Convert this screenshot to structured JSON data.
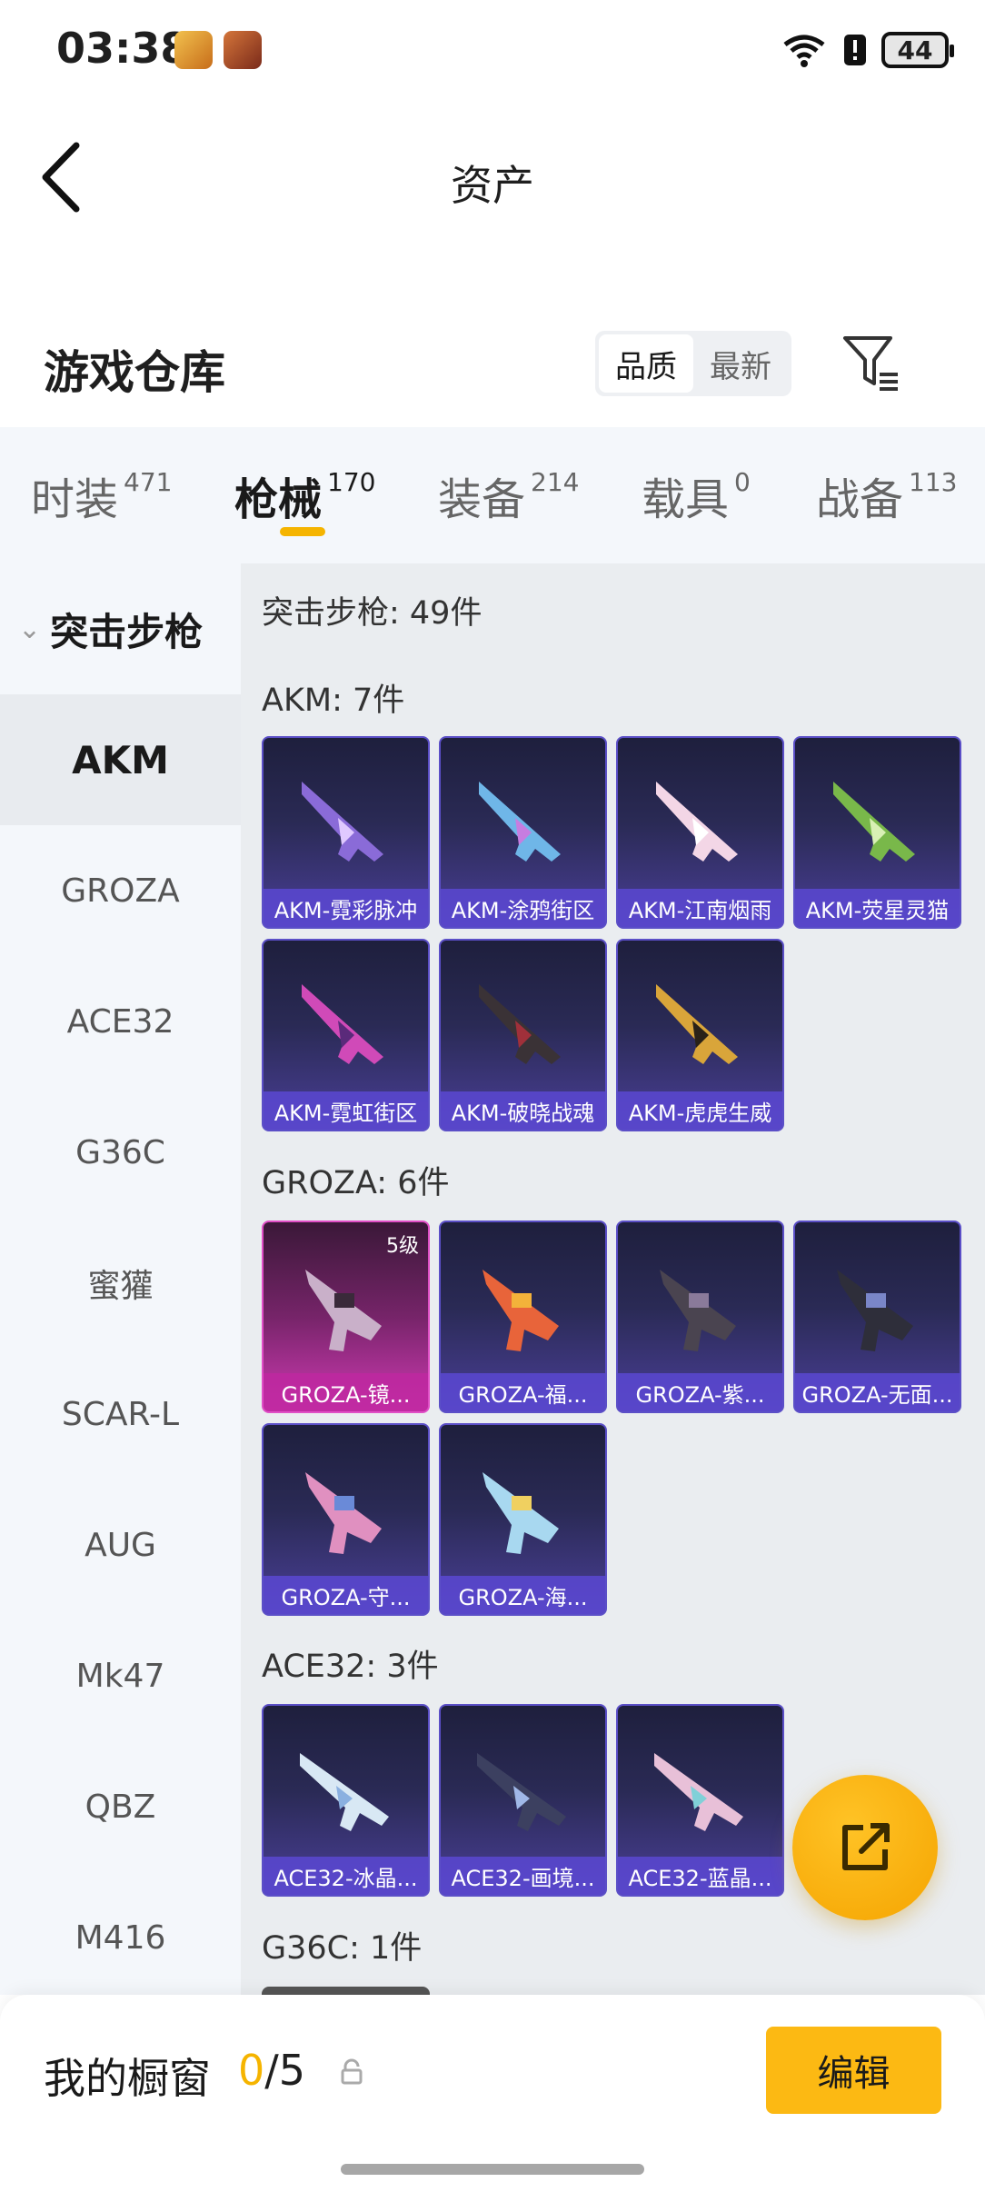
{
  "status_bar": {
    "time": "03:38",
    "battery": "44"
  },
  "header": {
    "title": "资产"
  },
  "warehouse": {
    "title": "游戏仓库",
    "sort_options": [
      "品质",
      "最新"
    ],
    "active_sort": "品质"
  },
  "tabs": [
    {
      "label": "时装",
      "count": "471"
    },
    {
      "label": "枪械",
      "count": "170"
    },
    {
      "label": "装备",
      "count": "214"
    },
    {
      "label": "载具",
      "count": "0"
    },
    {
      "label": "战备",
      "count": "113"
    }
  ],
  "active_tab": "枪械",
  "sidebar": {
    "category": "突击步枪",
    "items": [
      "AKM",
      "GROZA",
      "ACE32",
      "G36C",
      "蜜獾",
      "SCAR-L",
      "AUG",
      "Mk47",
      "QBZ",
      "M416"
    ],
    "active": "AKM"
  },
  "content": {
    "category_summary": "突击步枪: 49件",
    "sections": [
      {
        "label": "AKM: 7件",
        "items": [
          {
            "name": "AKM-霓彩脉冲"
          },
          {
            "name": "AKM-涂鸦街区"
          },
          {
            "name": "AKM-江南烟雨"
          },
          {
            "name": "AKM-荧星灵猫"
          },
          {
            "name": "AKM-霓虹街区"
          },
          {
            "name": "AKM-破晓战魂"
          },
          {
            "name": "AKM-虎虎生威"
          }
        ]
      },
      {
        "label": "GROZA: 6件",
        "items": [
          {
            "name": "GROZA-镜...",
            "level": "5级"
          },
          {
            "name": "GROZA-福..."
          },
          {
            "name": "GROZA-紫..."
          },
          {
            "name": "GROZA-无面..."
          },
          {
            "name": "GROZA-守..."
          },
          {
            "name": "GROZA-海..."
          }
        ]
      },
      {
        "label": "ACE32: 3件",
        "items": [
          {
            "name": "ACE32-冰晶..."
          },
          {
            "name": "ACE32-画境..."
          },
          {
            "name": "ACE32-蓝晶..."
          }
        ]
      },
      {
        "label": "G36C: 1件",
        "items": []
      }
    ]
  },
  "bottom_bar": {
    "label": "我的橱窗",
    "current": "0",
    "total": "/5",
    "button": "编辑"
  },
  "colors": {
    "accent": "#f5b400",
    "card_border": "#5b4fc7",
    "card_highlight": "#e04fc6"
  }
}
